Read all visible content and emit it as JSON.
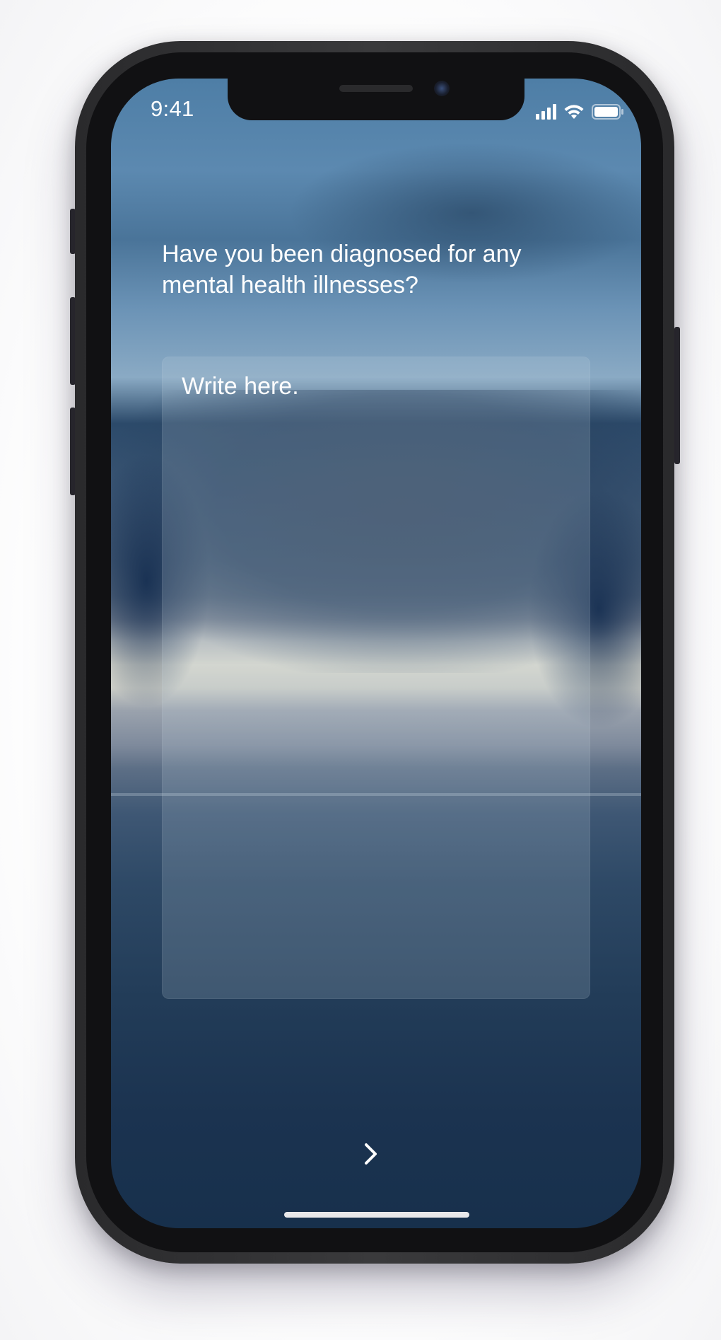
{
  "status_bar": {
    "time": "9:41",
    "signal_icon": "cellular-signal-icon",
    "wifi_icon": "wifi-icon",
    "battery_icon": "battery-icon"
  },
  "question": {
    "text": "Have you been diagnosed for any mental health illnesses?"
  },
  "answer": {
    "placeholder": "Write here.",
    "value": ""
  },
  "navigation": {
    "next_icon": "chevron-right-icon"
  },
  "colors": {
    "text": "#ffffff",
    "sky_top": "#4e7ea6",
    "sea": "#17304c"
  }
}
